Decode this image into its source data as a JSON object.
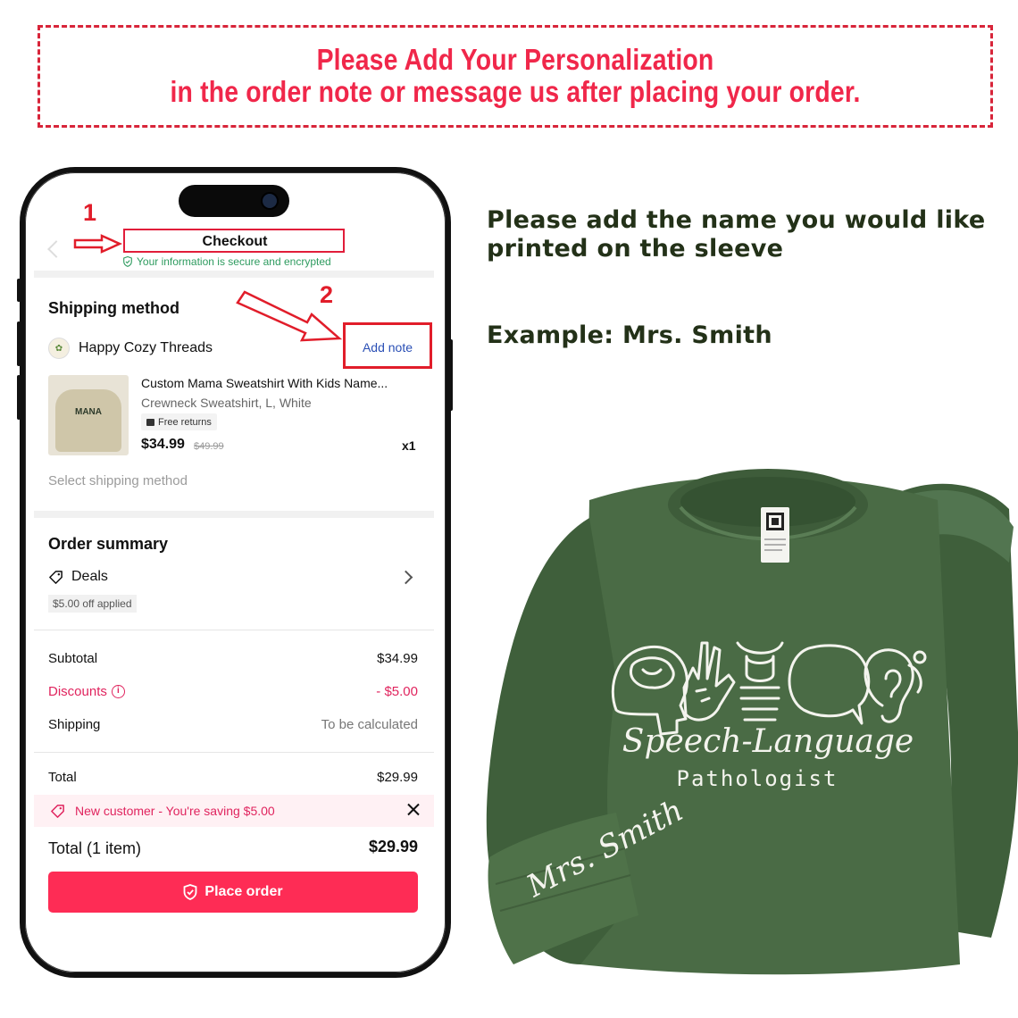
{
  "banner": {
    "line1": "Please Add Your Personalization",
    "line2": "in the order note or message us after placing your order."
  },
  "steps": {
    "step1": "1",
    "step2": "2"
  },
  "checkout": {
    "title": "Checkout",
    "secure_text": "Your information is secure and encrypted",
    "shipping_title": "Shipping method",
    "store_name": "Happy Cozy Threads",
    "add_note": "Add note",
    "product": {
      "name": "Custom Mama Sweatshirt With Kids Name...",
      "variant": "Crewneck Sweatshirt, L, White",
      "badge": "Free returns",
      "price": "$34.99",
      "old_price": "$49.99",
      "qty": "x1",
      "image_text": "MANA"
    },
    "select_shipping": "Select shipping method",
    "summary_title": "Order summary",
    "deals_label": "Deals",
    "deals_applied": "$5.00 off applied",
    "subtotal_label": "Subtotal",
    "subtotal_value": "$34.99",
    "discounts_label": "Discounts",
    "discounts_value": "- $5.00",
    "shipping_label": "Shipping",
    "shipping_value": "To be calculated",
    "total_label": "Total",
    "total_value": "$29.99",
    "promo_text": "New customer - You're saving $5.00",
    "grand_total_label": "Total (1 item)",
    "grand_total_value": "$29.99",
    "place_order": "Place order"
  },
  "instructions": {
    "text": "Please add the name you would like printed on the sleeve",
    "example": "Example: Mrs. Smith"
  },
  "sweatshirt": {
    "design_title": "Speech-Language",
    "design_subtitle": "Pathologist",
    "sleeve_name": "Mrs. Smith",
    "color": "#4a6b45"
  },
  "colors": {
    "banner_red": "#f0274a",
    "highlight_red": "#e11d2a",
    "accent_pink": "#fe2c55",
    "instruction_green": "#233118"
  }
}
